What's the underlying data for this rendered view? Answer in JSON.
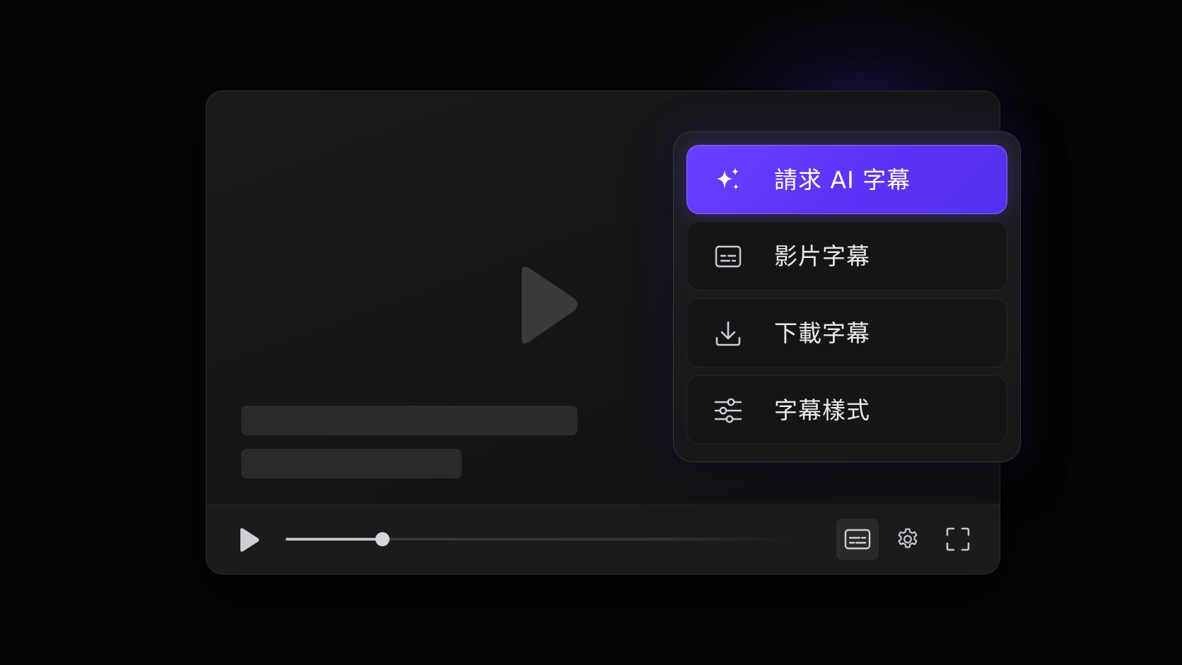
{
  "menu": {
    "items": [
      {
        "label": "請求 AI 字幕",
        "icon": "sparkles-icon",
        "active": true
      },
      {
        "label": "影片字幕",
        "icon": "subtitles-icon",
        "active": false
      },
      {
        "label": "下載字幕",
        "icon": "download-icon",
        "active": false
      },
      {
        "label": "字幕樣式",
        "icon": "sliders-icon",
        "active": false
      }
    ]
  },
  "player": {
    "progress": 0.19,
    "controls": {
      "play": "play-icon",
      "captions": "subtitles-icon",
      "settings": "gear-icon",
      "fullscreen": "fullscreen-icon"
    }
  },
  "colors": {
    "accent": "#5f38f8",
    "background": "#050505",
    "panel": "#18181b"
  }
}
